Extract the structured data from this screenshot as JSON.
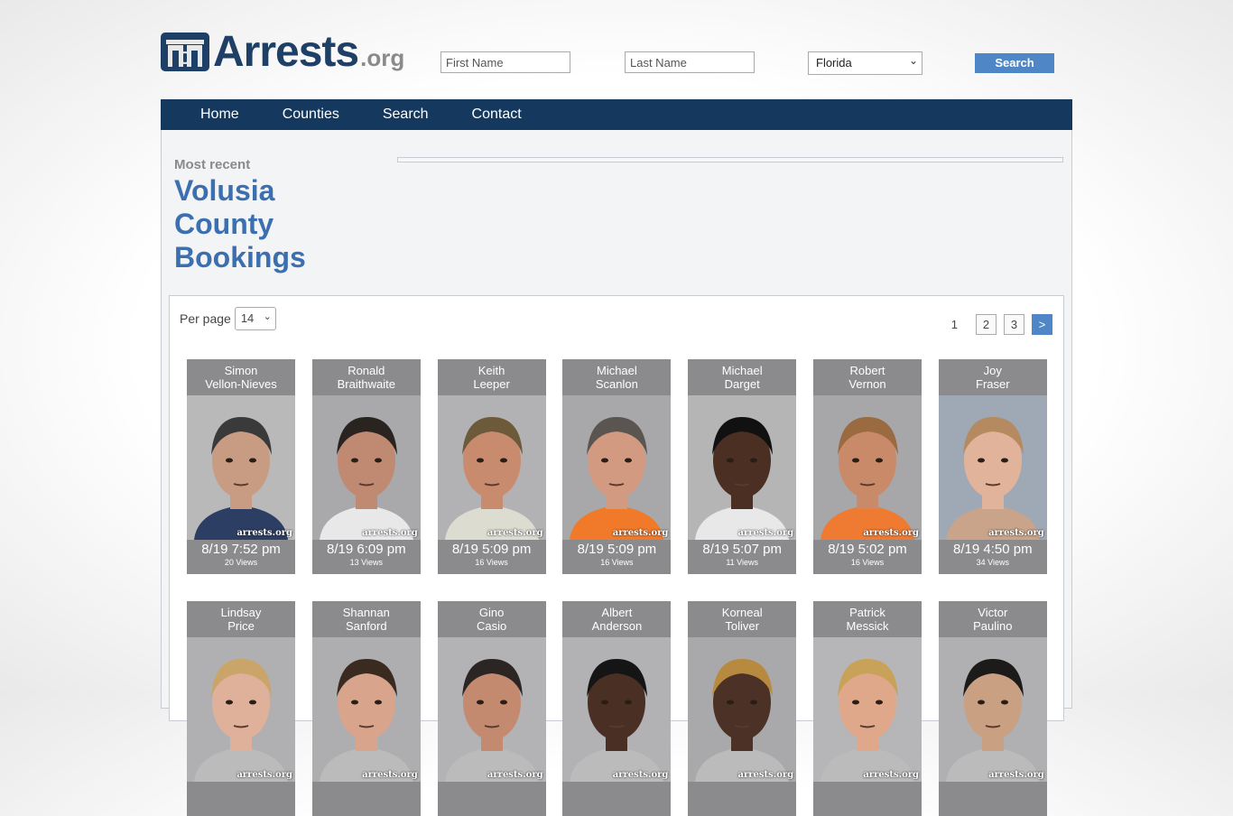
{
  "header": {
    "logo_main": "Arrests",
    "logo_tld": ".org",
    "first_name_placeholder": "First Name",
    "last_name_placeholder": "Last Name",
    "state_selected": "Florida",
    "search_label": "Search"
  },
  "nav": {
    "items": [
      "Home",
      "Counties",
      "Search",
      "Contact"
    ]
  },
  "heading": {
    "most_recent": "Most recent",
    "county_title": "Volusia County Bookings"
  },
  "controls": {
    "per_page_label": "Per page",
    "per_page_value": "14"
  },
  "pagination": {
    "current": "1",
    "pages": [
      "2",
      "3"
    ],
    "next": ">"
  },
  "watermark": "arrests.org",
  "bookings": [
    {
      "first": "Simon",
      "last": "Vellon-Nieves",
      "time": "8/19 7:52 pm",
      "views": "20 Views",
      "skin": "#c89c82",
      "hair": "#3a3a3a",
      "shirt": "#2c3e63",
      "bg": "#b9b9ba"
    },
    {
      "first": "Ronald",
      "last": "Braithwaite",
      "time": "8/19 6:09 pm",
      "views": "13 Views",
      "skin": "#c08a72",
      "hair": "#2a2420",
      "shirt": "#e8e8e8",
      "bg": "#a9a9ab"
    },
    {
      "first": "Keith",
      "last": "Leeper",
      "time": "8/19 5:09 pm",
      "views": "16 Views",
      "skin": "#c98b6e",
      "hair": "#6d5a3b",
      "shirt": "#dcdcd0",
      "bg": "#b2b2b4"
    },
    {
      "first": "Michael",
      "last": "Scanlon",
      "time": "8/19 5:09 pm",
      "views": "16 Views",
      "skin": "#d29a80",
      "hair": "#5a5550",
      "shirt": "#f07a2a",
      "bg": "#a8a8aa"
    },
    {
      "first": "Michael",
      "last": "Darget",
      "time": "8/19 5:07 pm",
      "views": "11 Views",
      "skin": "#4a2f22",
      "hair": "#111111",
      "shirt": "#e8e8e8",
      "bg": "#b5b5b6"
    },
    {
      "first": "Robert",
      "last": "Vernon",
      "time": "8/19 5:02 pm",
      "views": "16 Views",
      "skin": "#c98a6a",
      "hair": "#9a6a40",
      "shirt": "#ef7b33",
      "bg": "#a7a7a9"
    },
    {
      "first": "Joy",
      "last": "Fraser",
      "time": "8/19 4:50 pm",
      "views": "34 Views",
      "skin": "#e2b39b",
      "hair": "#b58a60",
      "shirt": "#c9a38a",
      "bg": "#9fa9b6"
    },
    {
      "first": "Lindsay",
      "last": "Price",
      "time": "",
      "views": "",
      "skin": "#e0b19a",
      "hair": "#c9a56a",
      "shirt": "#bbbbbb",
      "bg": "#b0b0b2"
    },
    {
      "first": "Shannan",
      "last": "Sanford",
      "time": "",
      "views": "",
      "skin": "#d9a48c",
      "hair": "#3a2a20",
      "shirt": "#bbbbbb",
      "bg": "#aeaeb0"
    },
    {
      "first": "Gino",
      "last": "Casio",
      "time": "",
      "views": "",
      "skin": "#c48a70",
      "hair": "#2b2624",
      "shirt": "#bbbbbb",
      "bg": "#b3b3b5"
    },
    {
      "first": "Albert",
      "last": "Anderson",
      "time": "",
      "views": "",
      "skin": "#4a3024",
      "hair": "#151515",
      "shirt": "#bbbbbb",
      "bg": "#b2b2b4"
    },
    {
      "first": "Korneal",
      "last": "Toliver",
      "time": "",
      "views": "",
      "skin": "#4c3226",
      "hair": "#b88a40",
      "shirt": "#bbbbbb",
      "bg": "#a9a9ab"
    },
    {
      "first": "Patrick",
      "last": "Messick",
      "time": "",
      "views": "",
      "skin": "#dfa88a",
      "hair": "#c9a25a",
      "shirt": "#bbbbbb",
      "bg": "#b6b6b8"
    },
    {
      "first": "Victor",
      "last": "Paulino",
      "time": "",
      "views": "",
      "skin": "#caa083",
      "hair": "#1d1b1a",
      "shirt": "#bbbbbb",
      "bg": "#b0b0b2"
    }
  ],
  "colors": {
    "brand_navy": "#15385f",
    "accent_blue": "#4f86c6",
    "title_blue": "#3b6fb0"
  }
}
